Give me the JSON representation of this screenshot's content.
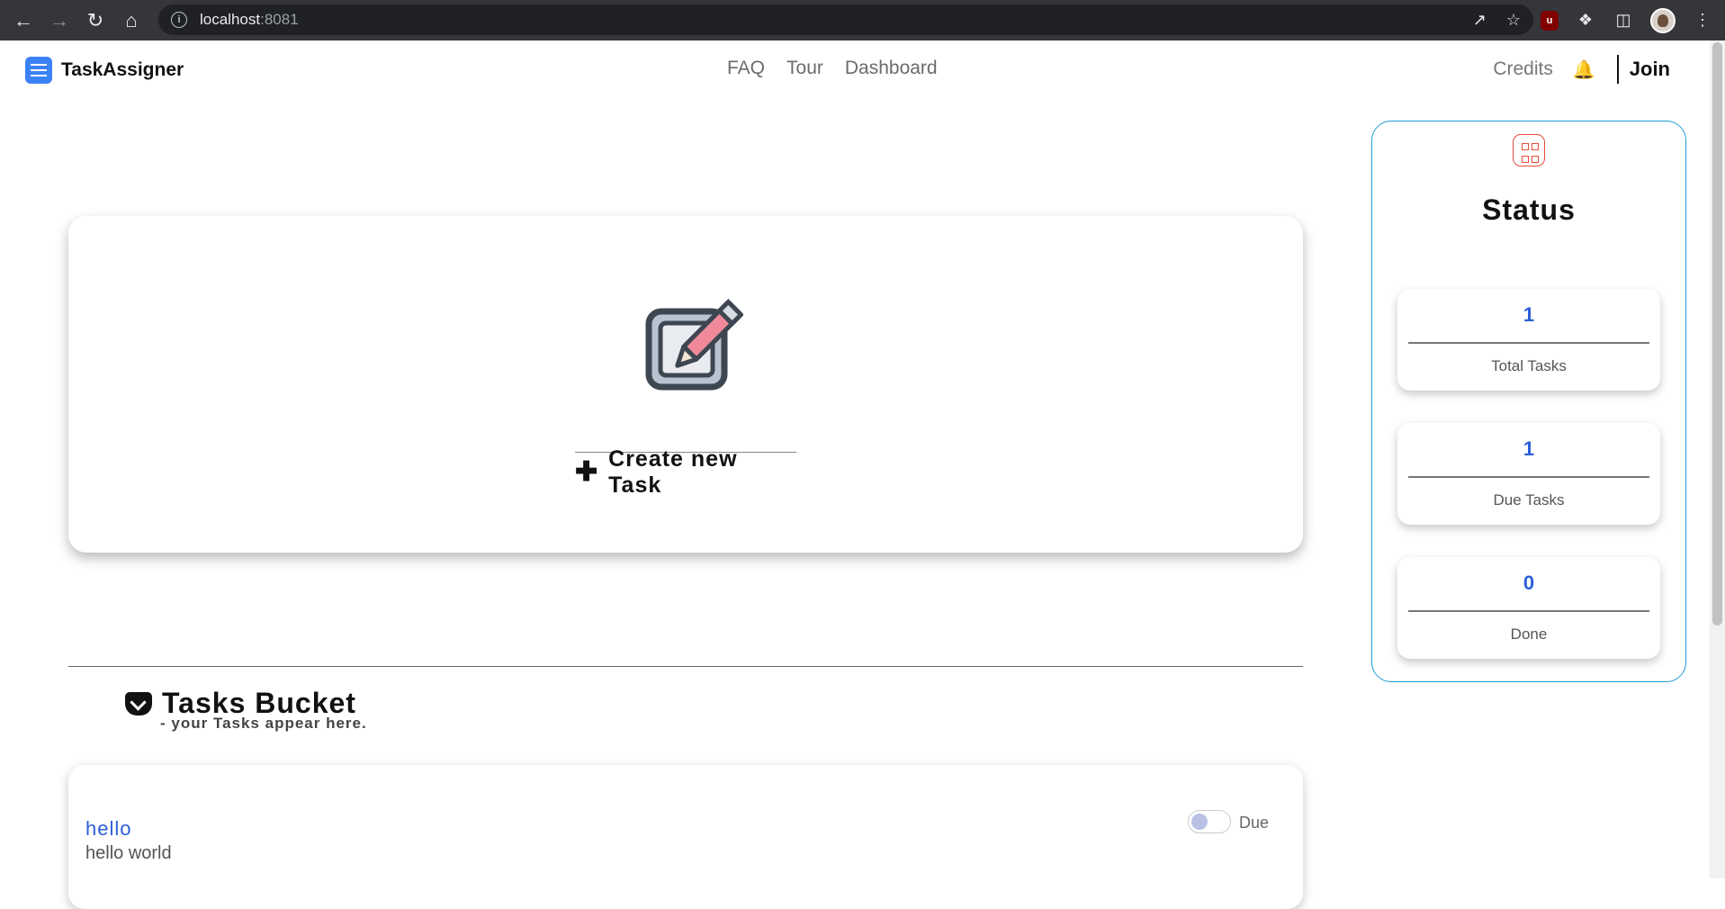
{
  "browser": {
    "url_host": "localhost",
    "url_port": ":8081"
  },
  "navbar": {
    "brand": "TaskAssigner",
    "links": [
      "FAQ",
      "Tour",
      "Dashboard"
    ],
    "credits": "Credits",
    "join": "Join"
  },
  "create": {
    "label": "Create new Task"
  },
  "status": {
    "title": "Status",
    "cards": [
      {
        "value": "1",
        "label": "Total Tasks"
      },
      {
        "value": "1",
        "label": "Due Tasks"
      },
      {
        "value": "0",
        "label": "Done"
      }
    ]
  },
  "bucket": {
    "title": "Tasks Bucket",
    "subtitle": "- your Tasks appear here."
  },
  "task": {
    "title": "hello",
    "description": "hello world",
    "toggle_label": "Due"
  },
  "colors": {
    "accent": "#2b5fd9",
    "status_border": "#1e9bd7",
    "brand_logo": "#3b82f6",
    "bell": "#c0392b"
  }
}
